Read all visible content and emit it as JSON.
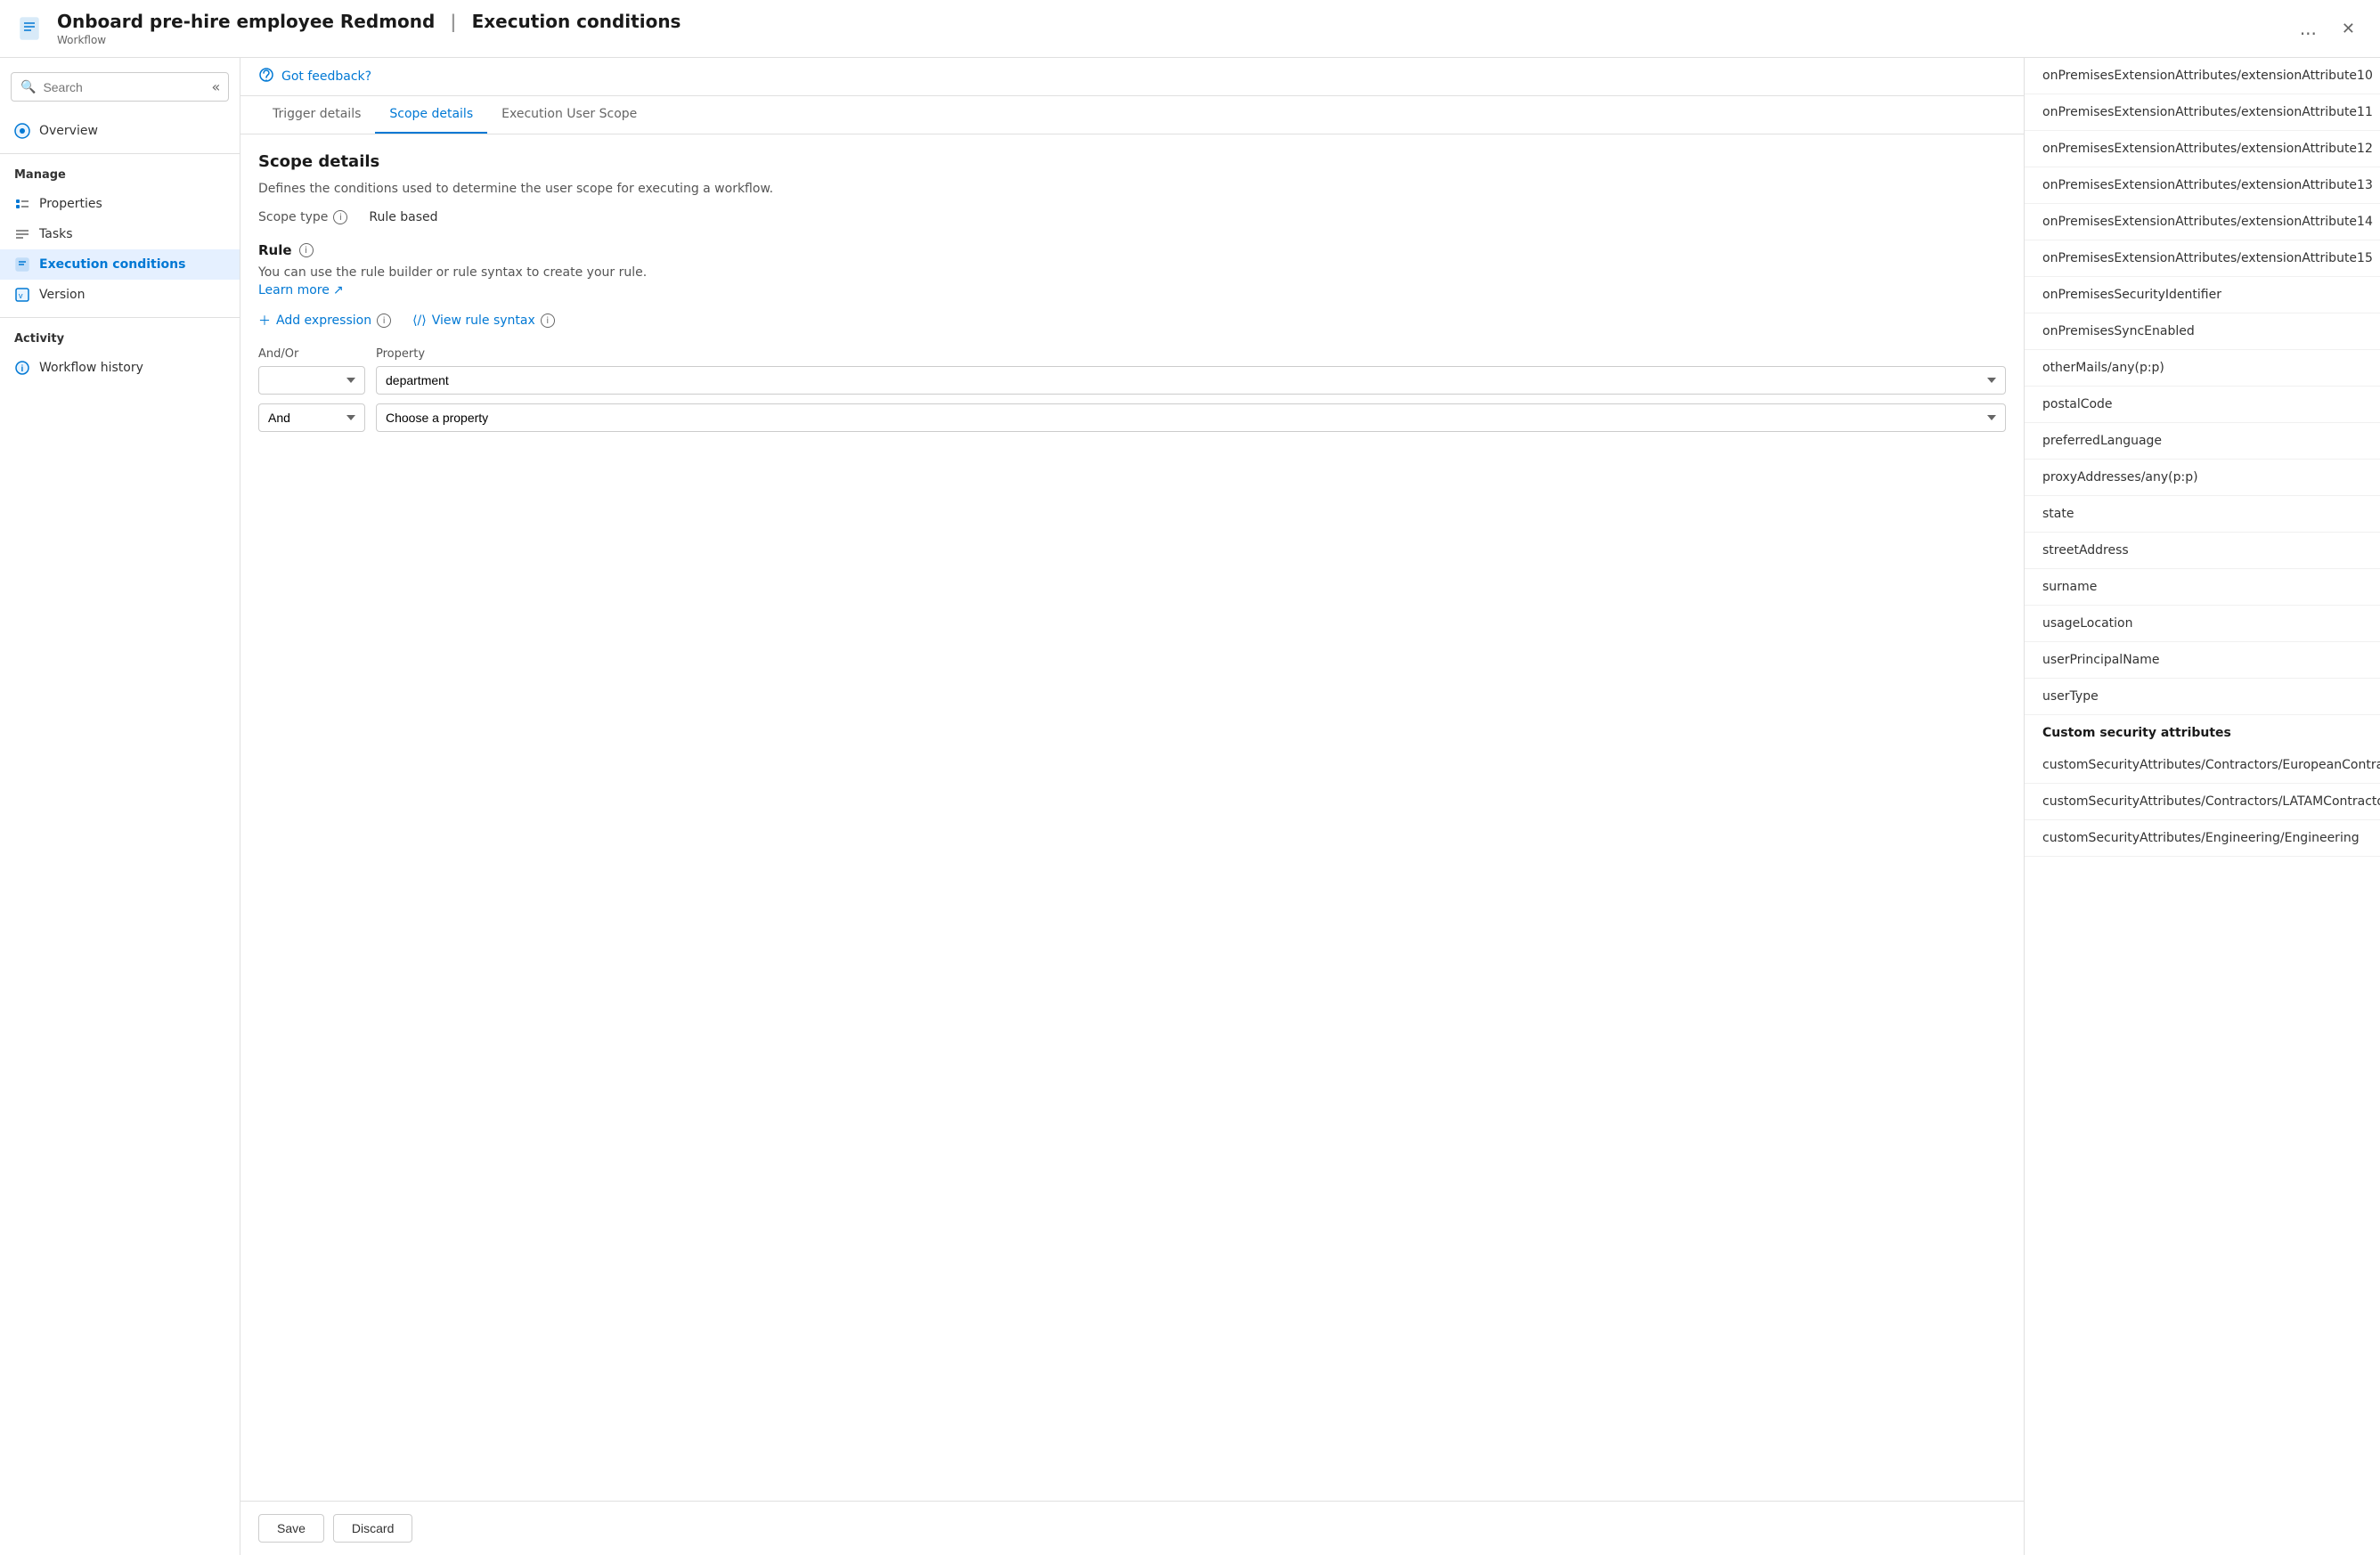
{
  "header": {
    "title": "Onboard pre-hire employee Redmond",
    "separator": "|",
    "subtitle_section": "Execution conditions",
    "workflow_label": "Workflow",
    "more_label": "...",
    "close_label": "✕"
  },
  "sidebar": {
    "search_placeholder": "Search",
    "collapse_label": "«",
    "manage_label": "Manage",
    "items_manage": [
      {
        "id": "properties",
        "label": "Properties",
        "icon": "bar-chart-icon"
      },
      {
        "id": "tasks",
        "label": "Tasks",
        "icon": "list-icon"
      },
      {
        "id": "execution-conditions",
        "label": "Execution conditions",
        "icon": "doc-icon",
        "active": true
      }
    ],
    "version_label": "Version",
    "version_icon": "version-icon",
    "activity_label": "Activity",
    "items_activity": [
      {
        "id": "workflow-history",
        "label": "Workflow history",
        "icon": "info-circle-icon"
      }
    ]
  },
  "feedback": {
    "icon": "feedback-icon",
    "label": "Got feedback?"
  },
  "tabs": [
    {
      "id": "trigger-details",
      "label": "Trigger details",
      "active": false
    },
    {
      "id": "scope-details",
      "label": "Scope details",
      "active": true
    },
    {
      "id": "execution-user-scope",
      "label": "Execution User Scope",
      "active": false
    }
  ],
  "scope_details": {
    "title": "Scope details",
    "description": "Defines the conditions used to determine the user scope for executing a workflow.",
    "scope_type_label": "Scope type",
    "scope_type_value": "Rule based",
    "rule_title": "Rule",
    "rule_description": "You can use the rule builder or rule syntax to create your rule.",
    "learn_more_label": "Learn more",
    "add_expression_label": "Add expression",
    "view_rule_syntax_label": "View rule syntax",
    "columns": {
      "and_or": "And/Or",
      "property": "Property"
    },
    "rows": [
      {
        "and_or": "",
        "property": "department"
      },
      {
        "and_or": "And",
        "property": "",
        "property_placeholder": "Choose a property"
      }
    ]
  },
  "footer": {
    "save_label": "Save",
    "discard_label": "Discard"
  },
  "right_panel": {
    "items": [
      "onPremisesExtensionAttributes/extensionAttribute10",
      "onPremisesExtensionAttributes/extensionAttribute11",
      "onPremisesExtensionAttributes/extensionAttribute12",
      "onPremisesExtensionAttributes/extensionAttribute13",
      "onPremisesExtensionAttributes/extensionAttribute14",
      "onPremisesExtensionAttributes/extensionAttribute15",
      "onPremisesSecurityIdentifier",
      "onPremisesSyncEnabled",
      "otherMails/any(p:p)",
      "postalCode",
      "preferredLanguage",
      "proxyAddresses/any(p:p)",
      "state",
      "streetAddress",
      "surname",
      "usageLocation",
      "userPrincipalName",
      "userType"
    ],
    "custom_security_label": "Custom security attributes",
    "custom_items": [
      "customSecurityAttributes/Contractors/EuropeanContractors",
      "customSecurityAttributes/Contractors/LATAMContractors",
      "customSecurityAttributes/Engineering/Engineering"
    ]
  }
}
